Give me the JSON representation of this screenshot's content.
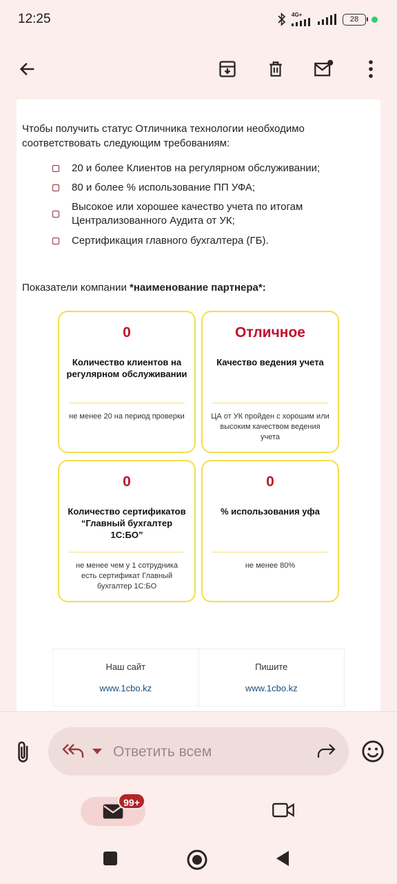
{
  "status_bar": {
    "time": "12:25",
    "network_label": "4G+",
    "battery_level": "28"
  },
  "toolbar": {
    "icons": [
      "back-arrow-icon",
      "archive-icon",
      "delete-icon",
      "mark-unread-icon",
      "more-vert-icon"
    ]
  },
  "email": {
    "intro": "Чтобы получить статус Отличника технологии необходимо соответствовать следующим требованиям:",
    "requirements": [
      "20 и более Клиентов на регулярном обслуживании;",
      "80 и более % использование ПП УФА;",
      "Высокое или хорошее качество учета по итогам Централизованного Аудита от УК;",
      "Сертификация главного бухгалтера (ГБ)."
    ],
    "company_prefix": "Показатели компании ",
    "company_name": "*наименование партнера*:",
    "cards": [
      {
        "value": "0",
        "title": "Количество клиентов на регулярном обслуживании",
        "note": "не менее 20 на период проверки"
      },
      {
        "value": "Отличное",
        "title": "Качество ведения учета",
        "note": "ЦА от УК пройден с хорошим или высоким качеством ведения учета"
      },
      {
        "value": "0",
        "title": "Количество сертификатов “Главный бухгалтер 1С:БО”",
        "note": "не менее чем у 1 сотрудника есть сертификат Главный бухгалтер 1С:БО"
      },
      {
        "value": "0",
        "title": "% использования уфа",
        "note": "не менее 80%"
      }
    ],
    "footer": [
      {
        "label": "Наш сайт",
        "link": "www.1cbo.kz"
      },
      {
        "label": "Пишите",
        "link": "www.1cbo.kz"
      }
    ]
  },
  "reply": {
    "placeholder": "Ответить всем"
  },
  "bottom_nav": {
    "mail_badge": "99+"
  },
  "colors": {
    "accent_red": "#c20f2f",
    "card_border": "#f2e04a",
    "app_background": "#fbeeed"
  }
}
